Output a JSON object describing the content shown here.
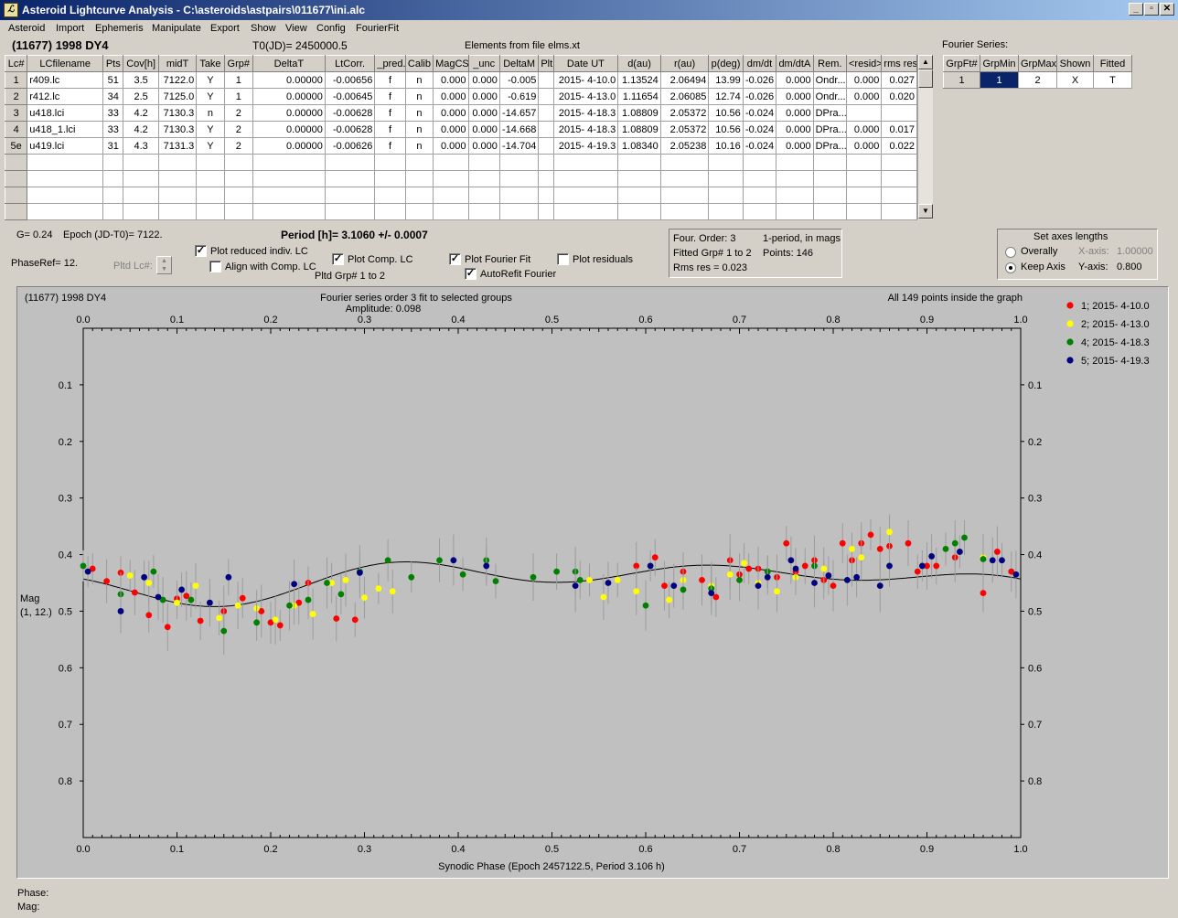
{
  "window": {
    "title": "Asteroid Lightcurve Analysis - C:\\asteroids\\astpairs\\011677\\ini.alc",
    "app_icon_text": "ℒ",
    "btn_min": "_",
    "btn_max": "▫",
    "btn_close": "✕"
  },
  "menu": [
    "Asteroid",
    "Import",
    "Ephemeris",
    "Manipulate",
    "Export",
    "Show",
    "View",
    "Config",
    "FourierFit"
  ],
  "header": {
    "asteroid": "(11677) 1998 DY4",
    "t0": "T0(JD)= 2450000.5",
    "elements": "Elements from file elms.xt",
    "fourier_title": "Fourier Series:"
  },
  "lc_table": {
    "columns": [
      "Lc#",
      "LCfilename",
      "Pts",
      "Cov[h]",
      "midT",
      "Take",
      "Grp#",
      "DeltaT",
      "LtCorr.",
      "_pred.",
      "Calib",
      "MagCS",
      "_unc",
      "DeltaM",
      "Plt",
      "Date UT",
      "d(au)",
      "r(au)",
      "p(deg)",
      "dm/dt",
      "dm/dtA",
      "Rem.",
      "<resid>",
      "rms res"
    ],
    "rows": [
      [
        "1",
        "r409.lc",
        "51",
        "3.5",
        "7122.0",
        "Y",
        "1",
        "0.00000",
        "-0.00656",
        "f",
        "n",
        "0.000",
        "0.000",
        "-0.005",
        "",
        "2015- 4-10.0",
        "1.13524",
        "2.06494",
        "13.99",
        "-0.026",
        "0.000",
        "Ondr...",
        "0.000",
        "0.027"
      ],
      [
        "2",
        "r412.lc",
        "34",
        "2.5",
        "7125.0",
        "Y",
        "1",
        "0.00000",
        "-0.00645",
        "f",
        "n",
        "0.000",
        "0.000",
        "-0.619",
        "",
        "2015- 4-13.0",
        "1.11654",
        "2.06085",
        "12.74",
        "-0.026",
        "0.000",
        "Ondr...",
        "0.000",
        "0.020"
      ],
      [
        "3",
        "u418.lci",
        "33",
        "4.2",
        "7130.3",
        "n",
        "2",
        "0.00000",
        "-0.00628",
        "f",
        "n",
        "0.000",
        "0.000",
        "-14.657",
        "",
        "2015- 4-18.3",
        "1.08809",
        "2.05372",
        "10.56",
        "-0.024",
        "0.000",
        "DPra...",
        "",
        ""
      ],
      [
        "4",
        "u418_1.lci",
        "33",
        "4.2",
        "7130.3",
        "Y",
        "2",
        "0.00000",
        "-0.00628",
        "f",
        "n",
        "0.000",
        "0.000",
        "-14.668",
        "",
        "2015- 4-18.3",
        "1.08809",
        "2.05372",
        "10.56",
        "-0.024",
        "0.000",
        "DPra...",
        "0.000",
        "0.017"
      ],
      [
        "5e",
        "u419.lci",
        "31",
        "4.3",
        "7131.3",
        "Y",
        "2",
        "0.00000",
        "-0.00626",
        "f",
        "n",
        "0.000",
        "0.000",
        "-14.704",
        "",
        "2015- 4-19.3",
        "1.08340",
        "2.05238",
        "10.16",
        "-0.024",
        "0.000",
        "DPra...",
        "0.000",
        "0.022"
      ]
    ]
  },
  "fourier_table": {
    "columns": [
      "GrpFt#",
      "GrpMin",
      "GrpMax",
      "Shown",
      "Fitted"
    ],
    "row": [
      "1",
      "1",
      "2",
      "X",
      "T"
    ]
  },
  "controls": {
    "g": "G= 0.24",
    "epoch": "Epoch (JD-T0)= 7122.",
    "period": "Period [h]= 3.1060 +/- 0.0007",
    "phaseref": "PhaseRef= 12.",
    "pltd_lc": "Pltd Lc#:",
    "plot_reduced": "Plot reduced indiv. LC",
    "align_comp": "Align with Comp. LC",
    "plot_comp": "Plot Comp. LC",
    "pltd_grp": "Pltd Grp#  1   to   2",
    "plot_fourier": "Plot Fourier Fit",
    "autorefit": "AutoRefit Fourier",
    "plot_residuals": "Plot residuals",
    "check": "✓",
    "fourier_info": [
      "Four. Order:  3",
      "1-period, in mags",
      "Fitted Grp# 1 to 2",
      "Points: 146",
      "Rms res     = 0.023"
    ],
    "axes_title": "Set axes lengths",
    "overally": "Overally",
    "keep_axis": "Keep Axis",
    "xaxis_label": "X-axis:",
    "xaxis_value": "1.00000",
    "yaxis_label": "Y-axis:",
    "yaxis_value": "0.800"
  },
  "status": {
    "phase": "Phase:",
    "mag": "Mag:"
  },
  "chart_data": {
    "type": "scatter",
    "title_left": "(11677) 1998 DY4",
    "title_center": "Fourier series order 3 fit to selected groups",
    "amplitude": "Amplitude: 0.098",
    "title_right": "All 149 points inside the graph",
    "xlabel": "Synodic Phase (Epoch 2457122.5, Period 3.106 h)",
    "ylabel": "Mag",
    "ylabel2": "(1, 12.)",
    "xlim": [
      0,
      1
    ],
    "ylim": [
      0.9,
      0.0
    ],
    "y_inverted": true,
    "x_ticks": [
      "0.0",
      "0.1",
      "0.2",
      "0.3",
      "0.4",
      "0.5",
      "0.6",
      "0.7",
      "0.8",
      "0.9",
      "1.0"
    ],
    "y_ticks": [
      "0.1",
      "0.2",
      "0.3",
      "0.4",
      "0.5",
      "0.6",
      "0.7",
      "0.8"
    ],
    "legend_position": "top-right",
    "series": [
      {
        "name": "1; 2015- 4-10.0",
        "color": "#ff0000",
        "x": [
          0.01,
          0.025,
          0.04,
          0.055,
          0.07,
          0.09,
          0.1,
          0.11,
          0.125,
          0.15,
          0.17,
          0.19,
          0.2,
          0.21,
          0.23,
          0.24,
          0.27,
          0.29,
          0.59,
          0.61,
          0.62,
          0.64,
          0.66,
          0.675,
          0.69,
          0.7,
          0.71,
          0.72,
          0.73,
          0.74,
          0.75,
          0.76,
          0.77,
          0.78,
          0.79,
          0.8,
          0.81,
          0.82,
          0.83,
          0.84,
          0.85,
          0.86,
          0.88,
          0.89,
          0.9,
          0.91,
          0.93,
          0.96,
          0.975,
          0.99
        ],
        "y": [
          0.425,
          0.447,
          0.432,
          0.467,
          0.507,
          0.528,
          0.478,
          0.473,
          0.517,
          0.5,
          0.477,
          0.5,
          0.52,
          0.525,
          0.485,
          0.45,
          0.513,
          0.515,
          0.42,
          0.405,
          0.455,
          0.43,
          0.445,
          0.475,
          0.41,
          0.435,
          0.425,
          0.425,
          0.43,
          0.44,
          0.38,
          0.43,
          0.42,
          0.41,
          0.445,
          0.455,
          0.38,
          0.41,
          0.38,
          0.365,
          0.39,
          0.385,
          0.38,
          0.43,
          0.42,
          0.42,
          0.405,
          0.468,
          0.395,
          0.43
        ]
      },
      {
        "name": "2; 2015- 4-13.0",
        "color": "#ffff00",
        "x": [
          0.05,
          0.07,
          0.1,
          0.12,
          0.145,
          0.165,
          0.185,
          0.205,
          0.225,
          0.245,
          0.265,
          0.28,
          0.3,
          0.315,
          0.33,
          0.54,
          0.555,
          0.57,
          0.59,
          0.625,
          0.64,
          0.67,
          0.69,
          0.705,
          0.72,
          0.74,
          0.76,
          0.79,
          0.82,
          0.83,
          0.86,
          0.96
        ],
        "y": [
          0.437,
          0.45,
          0.485,
          0.455,
          0.512,
          0.49,
          0.495,
          0.515,
          0.49,
          0.505,
          0.45,
          0.445,
          0.476,
          0.46,
          0.465,
          0.445,
          0.475,
          0.445,
          0.465,
          0.48,
          0.445,
          0.455,
          0.435,
          0.415,
          0.45,
          0.465,
          0.44,
          0.425,
          0.39,
          0.405,
          0.36,
          0.405
        ]
      },
      {
        "name": "4; 2015- 4-18.3",
        "color": "#008000",
        "x": [
          0.0,
          0.04,
          0.075,
          0.085,
          0.115,
          0.15,
          0.185,
          0.22,
          0.24,
          0.26,
          0.275,
          0.295,
          0.325,
          0.35,
          0.38,
          0.405,
          0.43,
          0.44,
          0.48,
          0.505,
          0.525,
          0.53,
          0.6,
          0.64,
          0.67,
          0.7,
          0.73,
          0.78,
          0.92,
          0.93,
          0.94,
          0.96
        ],
        "y": [
          0.42,
          0.47,
          0.43,
          0.48,
          0.48,
          0.535,
          0.52,
          0.49,
          0.48,
          0.45,
          0.47,
          0.43,
          0.41,
          0.44,
          0.41,
          0.435,
          0.41,
          0.447,
          0.44,
          0.43,
          0.43,
          0.445,
          0.49,
          0.462,
          0.46,
          0.445,
          0.43,
          0.42,
          0.39,
          0.38,
          0.37,
          0.408
        ]
      },
      {
        "name": "5; 2015- 4-19.3",
        "color": "#000080",
        "x": [
          0.005,
          0.04,
          0.065,
          0.08,
          0.105,
          0.135,
          0.155,
          0.225,
          0.295,
          0.395,
          0.43,
          0.525,
          0.56,
          0.605,
          0.63,
          0.67,
          0.72,
          0.73,
          0.755,
          0.76,
          0.78,
          0.795,
          0.815,
          0.825,
          0.85,
          0.86,
          0.895,
          0.905,
          0.935,
          0.97,
          0.98,
          0.995
        ],
        "y": [
          0.43,
          0.5,
          0.44,
          0.475,
          0.462,
          0.485,
          0.44,
          0.452,
          0.432,
          0.41,
          0.42,
          0.455,
          0.45,
          0.42,
          0.455,
          0.468,
          0.455,
          0.44,
          0.41,
          0.425,
          0.45,
          0.437,
          0.445,
          0.44,
          0.455,
          0.42,
          0.42,
          0.403,
          0.395,
          0.41,
          0.41,
          0.435
        ]
      }
    ]
  }
}
